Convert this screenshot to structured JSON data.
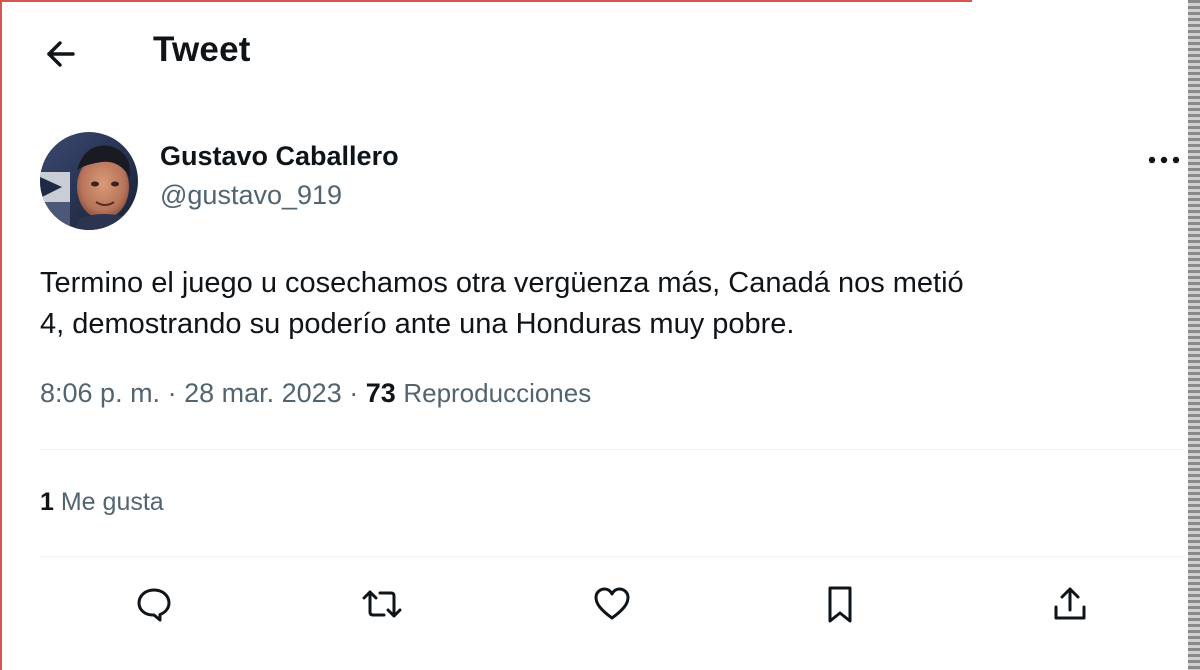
{
  "header": {
    "title": "Tweet",
    "back_icon": "arrow-left-icon"
  },
  "tweet": {
    "author": {
      "name": "Gustavo Caballero",
      "handle": "@gustavo_919"
    },
    "text_line1": "Termino el juego u cosechamos otra vergüenza más, Canadá nos metió",
    "text_line2": "4, demostrando su poderío ante una Honduras muy pobre.",
    "time": "8:06 p. m.",
    "separator": "·",
    "date": "28 mar. 2023",
    "views_count": "73",
    "views_label": "Reproducciones",
    "likes_count": "1",
    "likes_label": "Me gusta"
  },
  "actions": [
    {
      "name": "reply",
      "icon": "reply-icon"
    },
    {
      "name": "retweet",
      "icon": "retweet-icon"
    },
    {
      "name": "like",
      "icon": "heart-icon"
    },
    {
      "name": "bookmark",
      "icon": "bookmark-icon"
    },
    {
      "name": "share",
      "icon": "share-icon"
    }
  ],
  "colors": {
    "text": "#0f1419",
    "secondary": "#536471",
    "divider": "#eff3f4",
    "frame_accent": "#d9534f"
  }
}
